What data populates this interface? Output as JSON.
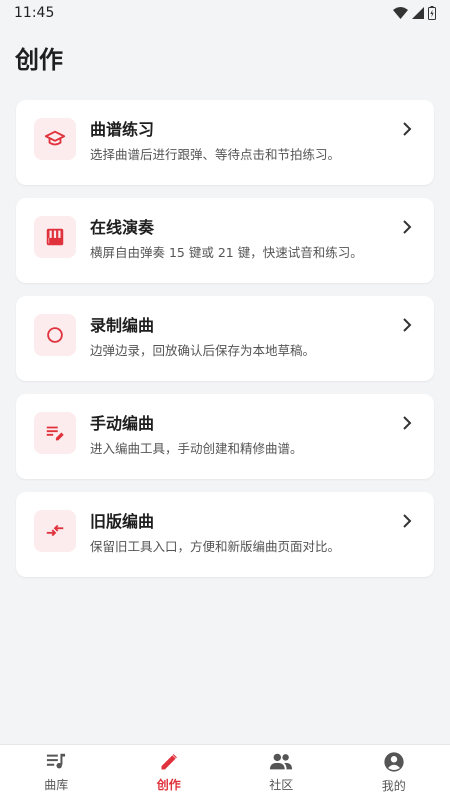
{
  "status": {
    "time": "11:45"
  },
  "page": {
    "title": "创作"
  },
  "accent_color": "#e0323c",
  "cards": [
    {
      "icon": "graduation-cap-icon",
      "title": "曲谱练习",
      "desc": "选择曲谱后进行跟弹、等待点击和节拍练习。"
    },
    {
      "icon": "piano-keys-icon",
      "title": "在线演奏",
      "desc": "横屏自由弹奏 15 键或 21 键，快速试音和练习。"
    },
    {
      "icon": "record-circle-icon",
      "title": "录制编曲",
      "desc": "边弹边录，回放确认后保存为本地草稿。"
    },
    {
      "icon": "edit-list-icon",
      "title": "手动编曲",
      "desc": "进入编曲工具，手动创建和精修曲谱。"
    },
    {
      "icon": "compare-arrows-icon",
      "title": "旧版编曲",
      "desc": "保留旧工具入口，方便和新版编曲页面对比。"
    }
  ],
  "nav": {
    "items": [
      {
        "label": "曲库",
        "icon": "music-list-icon",
        "active": false
      },
      {
        "label": "创作",
        "icon": "pencil-icon",
        "active": true
      },
      {
        "label": "社区",
        "icon": "people-icon",
        "active": false
      },
      {
        "label": "我的",
        "icon": "account-icon",
        "active": false
      }
    ]
  }
}
